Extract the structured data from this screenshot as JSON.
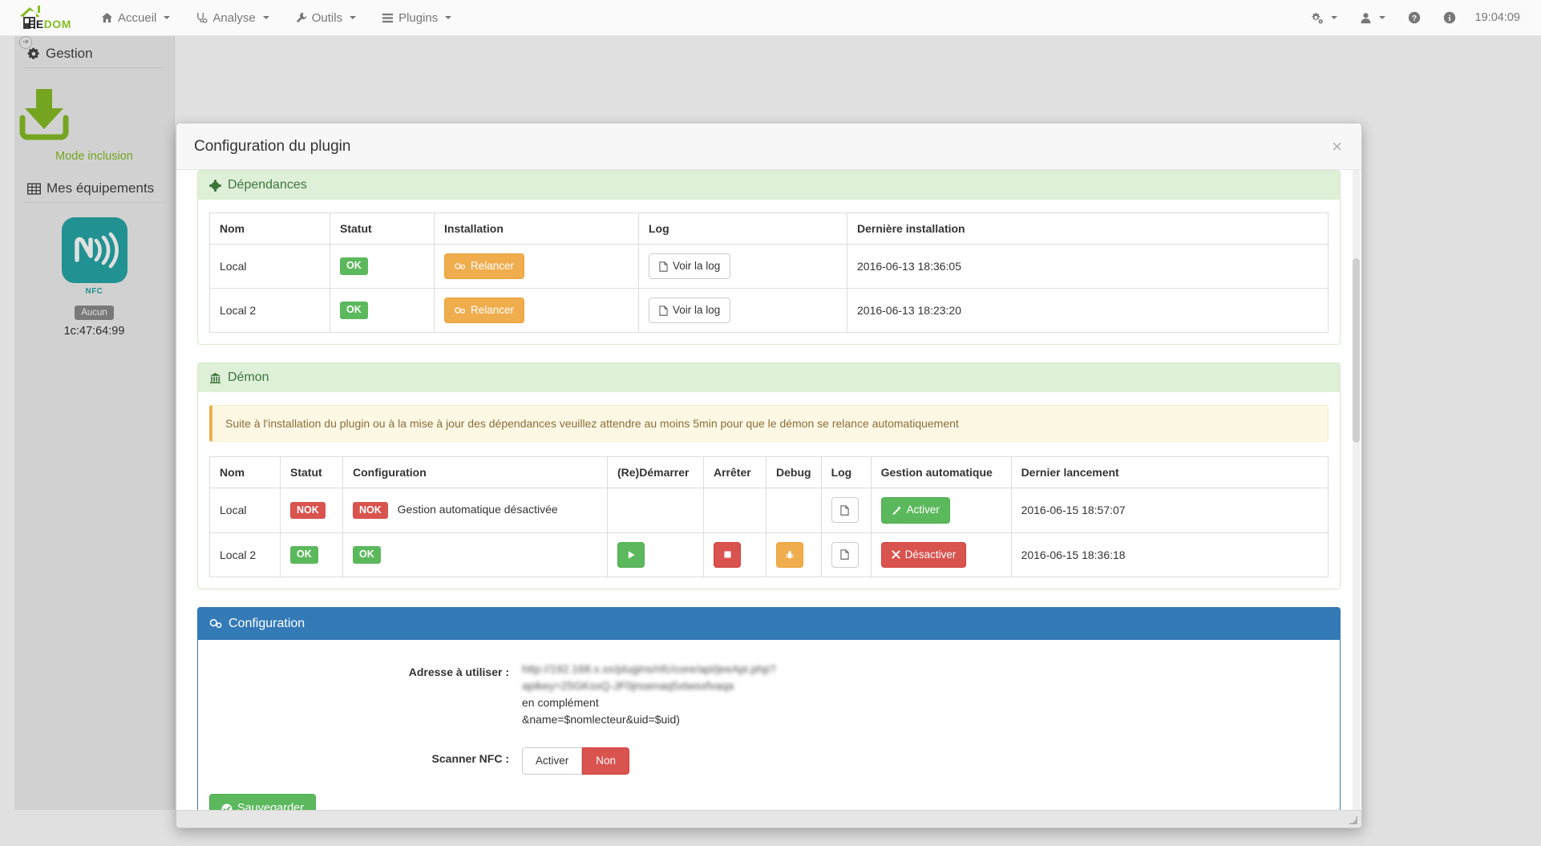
{
  "navbar": {
    "brand": {
      "ee": "EE",
      "dom": "DOM"
    },
    "items": [
      {
        "label": "Accueil",
        "icon": "home-icon",
        "caret": true
      },
      {
        "label": "Analyse",
        "icon": "stethoscope-icon",
        "caret": true
      },
      {
        "label": "Outils",
        "icon": "wrench-icon",
        "caret": true
      },
      {
        "label": "Plugins",
        "icon": "list-icon",
        "caret": true
      }
    ],
    "right": [
      {
        "name": "gears-icon",
        "caret": true
      },
      {
        "name": "user-icon",
        "caret": true
      },
      {
        "name": "question-circle-icon",
        "caret": false
      },
      {
        "name": "info-circle-icon",
        "caret": false
      }
    ],
    "clock": "19:04:09"
  },
  "sidebar": {
    "gestion_title": "Gestion",
    "inclusion_label": "Mode inclusion",
    "equipements_title": "Mes équipements",
    "equipment": {
      "name": "NFC",
      "status_badge": "Aucun",
      "mac": "1c:47:64:99"
    }
  },
  "modal": {
    "title": "Configuration du plugin",
    "close_label": "×"
  },
  "dependencies": {
    "section_title": "Dépendances",
    "columns": [
      "Nom",
      "Statut",
      "Installation",
      "Log",
      "Dernière installation"
    ],
    "rows": [
      {
        "nom": "Local",
        "statut": "OK",
        "statut_type": "ok",
        "install_button": "Relancer",
        "log_button": "Voir la log",
        "last_install": "2016-06-13 18:36:05"
      },
      {
        "nom": "Local 2",
        "statut": "OK",
        "statut_type": "ok",
        "install_button": "Relancer",
        "log_button": "Voir la log",
        "last_install": "2016-06-13 18:23:20"
      }
    ]
  },
  "daemon": {
    "section_title": "Démon",
    "alert": "Suite à l'installation du plugin ou à la mise à jour des dépendances veuillez attendre au moins 5min pour que le démon se relance automatiquement",
    "columns": [
      "Nom",
      "Statut",
      "Configuration",
      "(Re)Démarrer",
      "Arrêter",
      "Debug",
      "Log",
      "Gestion automatique",
      "Dernier lancement"
    ],
    "rows": [
      {
        "nom": "Local",
        "statut": "NOK",
        "statut_type": "nok",
        "config_badge": "NOK",
        "config_badge_type": "nok",
        "config_text": "Gestion automatique désactivée",
        "has_restart": false,
        "has_stop": false,
        "has_debug": false,
        "auto_button": "Activer",
        "auto_button_type": "success",
        "last_launch": "2016-06-15 18:57:07"
      },
      {
        "nom": "Local 2",
        "statut": "OK",
        "statut_type": "ok",
        "config_badge": "OK",
        "config_badge_type": "ok",
        "config_text": "",
        "has_restart": true,
        "has_stop": true,
        "has_debug": true,
        "auto_button": "Désactiver",
        "auto_button_type": "danger",
        "last_launch": "2016-06-15 18:36:18"
      }
    ]
  },
  "configuration": {
    "section_title": "Configuration",
    "address_label": "Adresse à utiliser :",
    "address_line1": "http://192.168.x.xx/plugins/nfc/core/api/jeeApi.php?",
    "address_line2": "apikey=25GKsxQ-JF0jnoenaq5xtwsxfvaqa",
    "address_line3": "en complément",
    "address_line4": "&name=$nomlecteur&uid=$uid)",
    "scanner_label": "Scanner NFC :",
    "scanner_on_label": "Activer",
    "scanner_off_label": "Non",
    "scanner_value": "Non",
    "save_label": "Sauvegarder"
  },
  "colors": {
    "brand_green": "#86bc25",
    "success": "#5cb85c",
    "danger": "#d9534f",
    "warning": "#f0ad4e",
    "primary": "#337ab7",
    "teal": "#27a5a5"
  }
}
